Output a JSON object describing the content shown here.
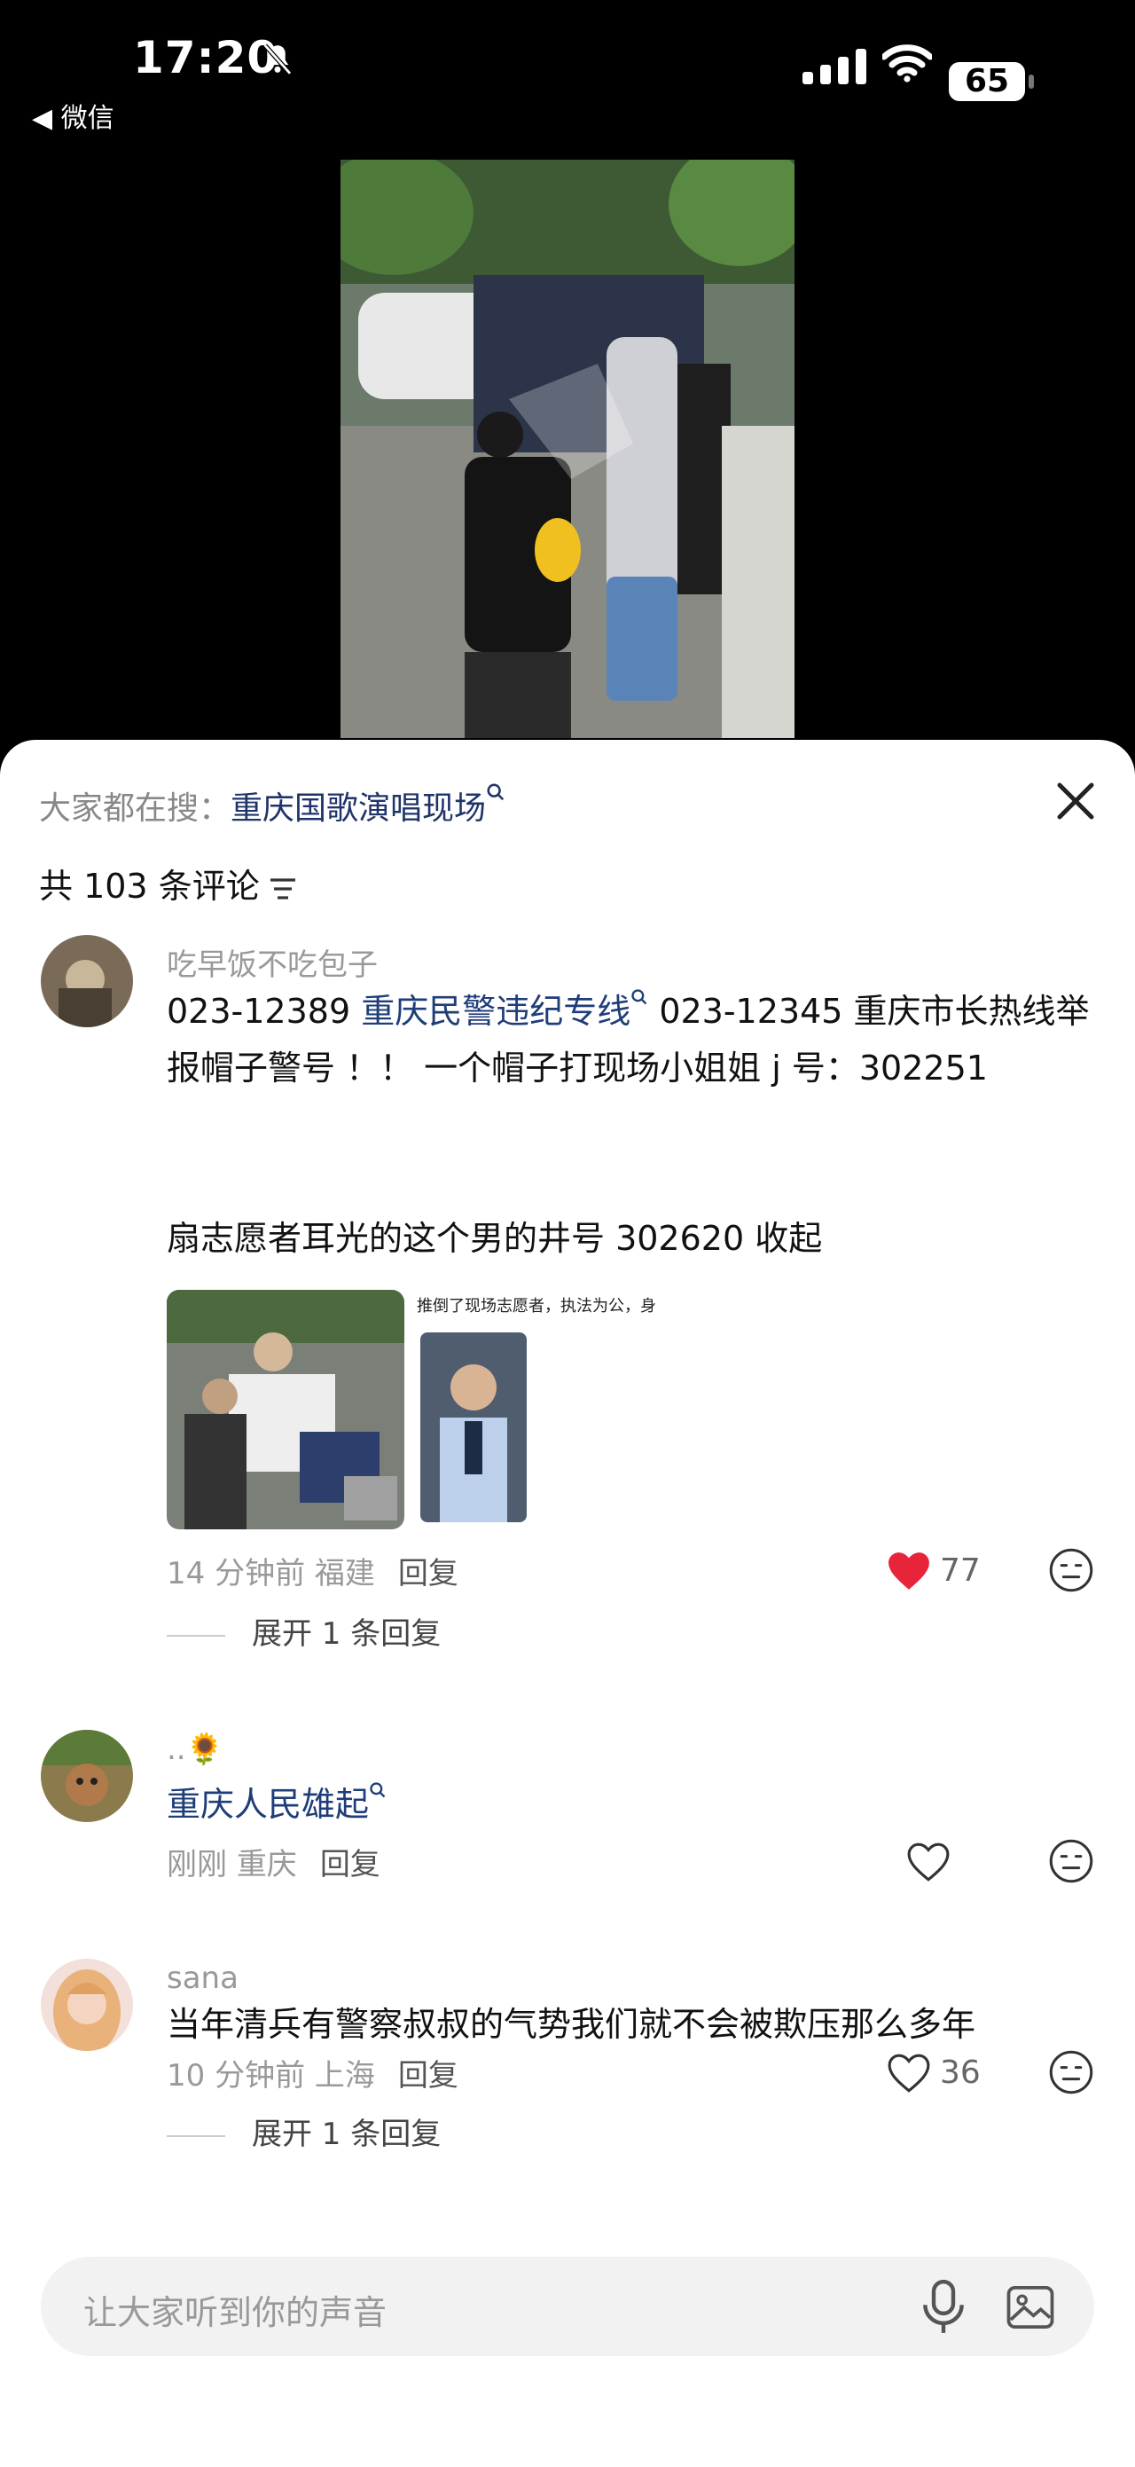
{
  "status": {
    "time": "17:20",
    "back_label": "◀ 微信",
    "battery": "65"
  },
  "search": {
    "prefix": "大家都在搜：",
    "term": "重庆国歌演唱现场"
  },
  "comments_header": {
    "label": "共 103 条评论"
  },
  "comments": [
    {
      "user": "吃早饭不吃包子",
      "text_parts": [
        "023-12389 ",
        "重庆民警违纪专线",
        " 023-12345  重庆市长热线举报帽子警号  ！！ 一个帽子打现场小姐姐 j 号：302251"
      ],
      "text_line2": "扇志愿者耳光的这个男的井号 302620 收起",
      "thumb_caption": "推倒了现场志愿者，执法为公，身",
      "meta_time": "14 分钟前",
      "meta_region": "福建",
      "reply": "回复",
      "likes": "77",
      "liked": true,
      "expand": "展开 1 条回复"
    },
    {
      "user": "..🌻",
      "text": "重庆人民雄起",
      "meta_time": "刚刚",
      "meta_region": "重庆",
      "reply": "回复",
      "likes": "",
      "liked": false
    },
    {
      "user": "sana",
      "text": "当年清兵有警察叔叔的气势我们就不会被欺压那么多年",
      "meta_time": "10 分钟前",
      "meta_region": "上海",
      "reply": "回复",
      "likes": "36",
      "liked": false,
      "expand": "展开 1 条回复"
    }
  ],
  "input": {
    "placeholder": "让大家听到你的声音"
  },
  "colors": {
    "link": "#1f3d78",
    "heart_liked": "#e8243b",
    "sheet_bg": "#ffffff"
  },
  "icons": [
    "bell-slash-icon",
    "signal-icon",
    "wifi-icon",
    "close-icon",
    "sort-icon",
    "search-hint-icon",
    "heart-icon",
    "emoji-icon",
    "microphone-icon",
    "image-icon"
  ]
}
